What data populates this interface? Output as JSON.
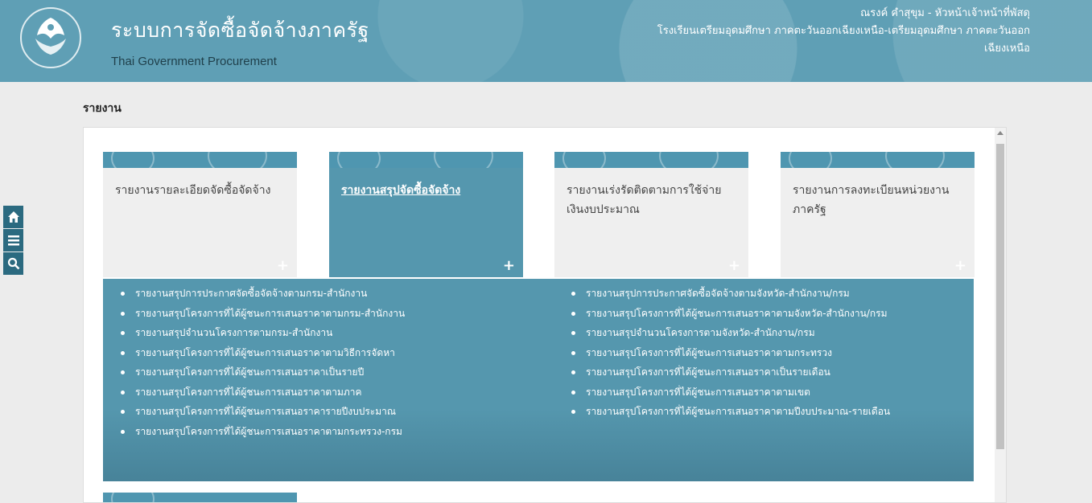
{
  "header": {
    "title": "ระบบการจัดซื้อจัดจ้างภาครัฐ",
    "subtitle": "Thai Government Procurement",
    "user_line": "ณรงค์ คำสุขุม - หัวหน้าเจ้าหน้าที่พัสดุ",
    "org_line": "โรงเรียนเตรียมอุดมศึกษา ภาคตะวันออกเฉียงเหนือ-เตรียมอุดมศึกษา ภาคตะวันออก",
    "org_line2": "เฉียงเหนือ"
  },
  "page": {
    "heading": "รายงาน"
  },
  "side_tools": [
    {
      "icon": "home-icon"
    },
    {
      "icon": "menu-icon"
    },
    {
      "icon": "search-icon"
    }
  ],
  "cards": [
    {
      "label": "รายงานรายละเอียดจัดซื้อจัดจ้าง",
      "plus": "+"
    },
    {
      "label": "รายงานสรุปจัดซื้อจัดจ้าง",
      "plus": "+"
    },
    {
      "label": "รายงานเร่งรัดติดตามการใช้จ่ายเงินงบประมาณ",
      "plus": "+"
    },
    {
      "label": "รายงานการลงทะเบียนหน่วยงานภาครัฐ",
      "plus": "+"
    }
  ],
  "submenu": {
    "col1": [
      "รายงานสรุปการประกาศจัดซื้อจัดจ้างตามกรม-สำนักงาน",
      "รายงานสรุปโครงการที่ได้ผู้ชนะการเสนอราคาตามกรม-สำนักงาน",
      "รายงานสรุปจำนวนโครงการตามกรม-สำนักงาน",
      "รายงานสรุปโครงการที่ได้ผู้ชนะการเสนอราคาตามวิธีการจัดหา",
      "รายงานสรุปโครงการที่ได้ผู้ชนะการเสนอราคาเป็นรายปี",
      "รายงานสรุปโครงการที่ได้ผู้ชนะการเสนอราคาตามภาค",
      "รายงานสรุปโครงการที่ได้ผู้ชนะการเสนอราคารายปีงบประมาณ",
      "รายงานสรุปโครงการที่ได้ผู้ชนะการเสนอราคาตามกระทรวง-กรม"
    ],
    "col2": [
      "รายงานสรุปการประกาศจัดซื้อจัดจ้างตามจังหวัด-สำนักงาน/กรม",
      "รายงานสรุปโครงการที่ได้ผู้ชนะการเสนอราคาตามจังหวัด-สำนักงาน/กรม",
      "รายงานสรุปจำนวนโครงการตามจังหวัด-สำนักงาน/กรม",
      "รายงานสรุปโครงการที่ได้ผู้ชนะการเสนอราคาตามกระทรวง",
      "รายงานสรุปโครงการที่ได้ผู้ชนะการเสนอราคาเป็นรายเดือน",
      "รายงานสรุปโครงการที่ได้ผู้ชนะการเสนอราคาตามเขต",
      "รายงานสรุปโครงการที่ได้ผู้ชนะการเสนอราคาตามปีงบประมาณ-รายเดือน"
    ]
  },
  "colors": {
    "header": "#5f9fb5",
    "accent": "#5597ae",
    "tool": "#2b6a80"
  }
}
